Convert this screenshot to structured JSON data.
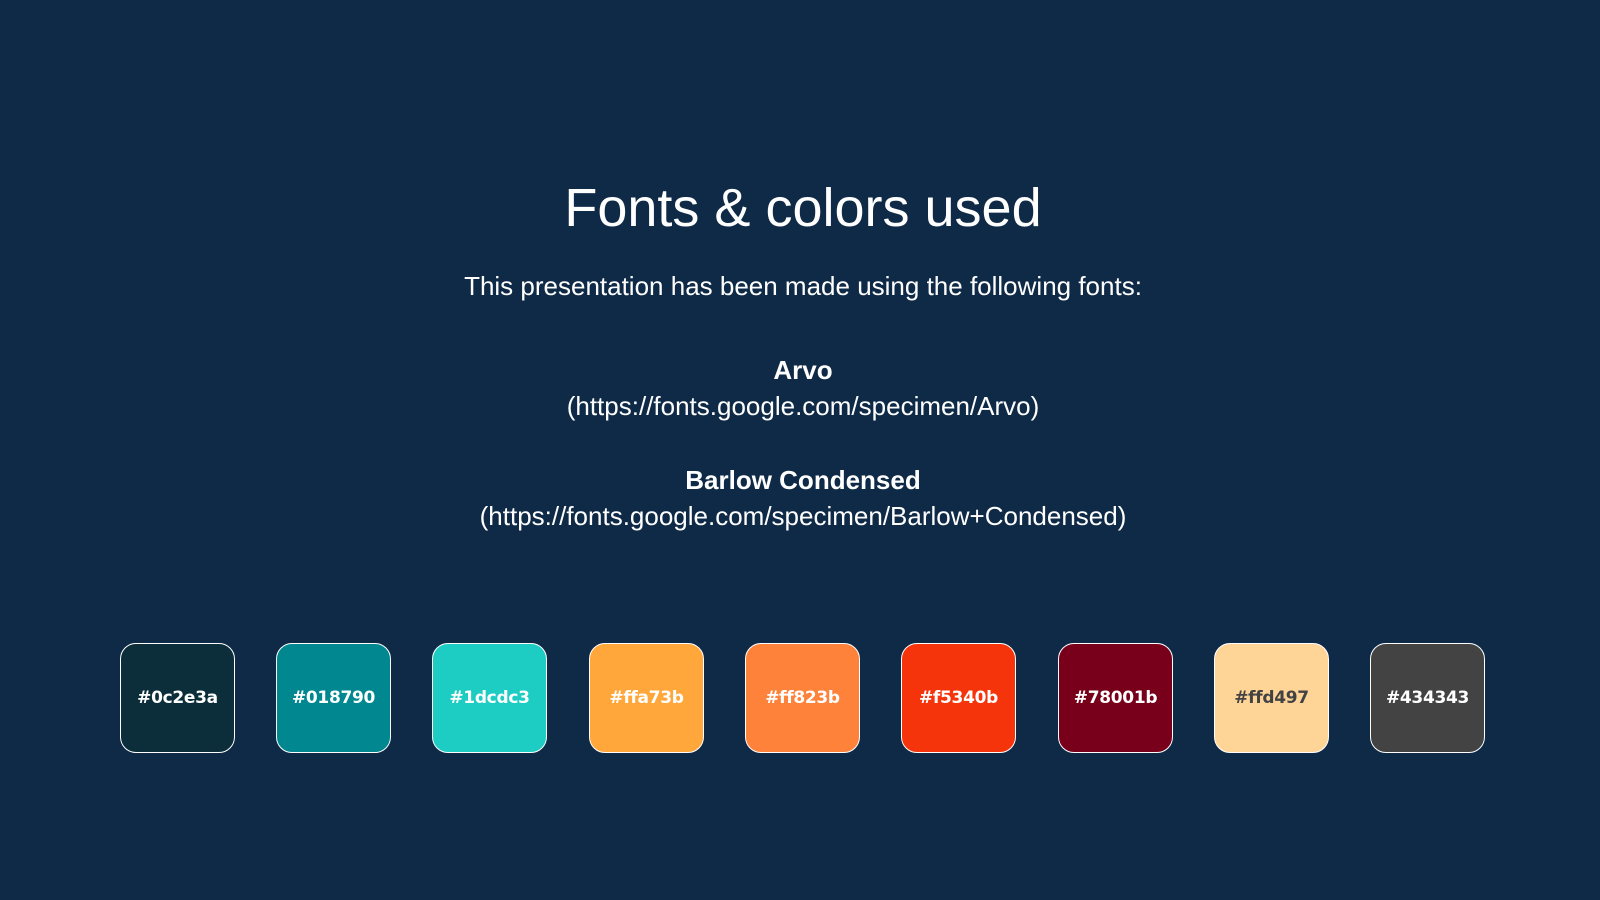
{
  "background": "#0f2a47",
  "title": "Fonts & colors used",
  "subtitle": "This presentation has been made using the following fonts:",
  "fonts": [
    {
      "name": "Arvo",
      "url": "(https://fonts.google.com/specimen/Arvo)"
    },
    {
      "name": "Barlow Condensed",
      "url": "(https://fonts.google.com/specimen/Barlow+Condensed)"
    }
  ],
  "colors": [
    {
      "label": "#0c2e3a",
      "hex": "#0c2e3a",
      "text": "#ffffff"
    },
    {
      "label": "#018790",
      "hex": "#018790",
      "text": "#ffffff"
    },
    {
      "label": "#1dcdc3",
      "hex": "#1dcdc3",
      "text": "#ffffff"
    },
    {
      "label": "#ffa73b",
      "hex": "#ffa73b",
      "text": "#ffffff"
    },
    {
      "label": "#ff823b",
      "hex": "#ff823b",
      "text": "#ffffff"
    },
    {
      "label": "#f5340b",
      "hex": "#f5340b",
      "text": "#ffffff"
    },
    {
      "label": "#78001b",
      "hex": "#78001b",
      "text": "#ffffff"
    },
    {
      "label": "#ffd497",
      "hex": "#ffd497",
      "text": "#434343"
    },
    {
      "label": "#434343",
      "hex": "#434343",
      "text": "#ffffff"
    }
  ]
}
